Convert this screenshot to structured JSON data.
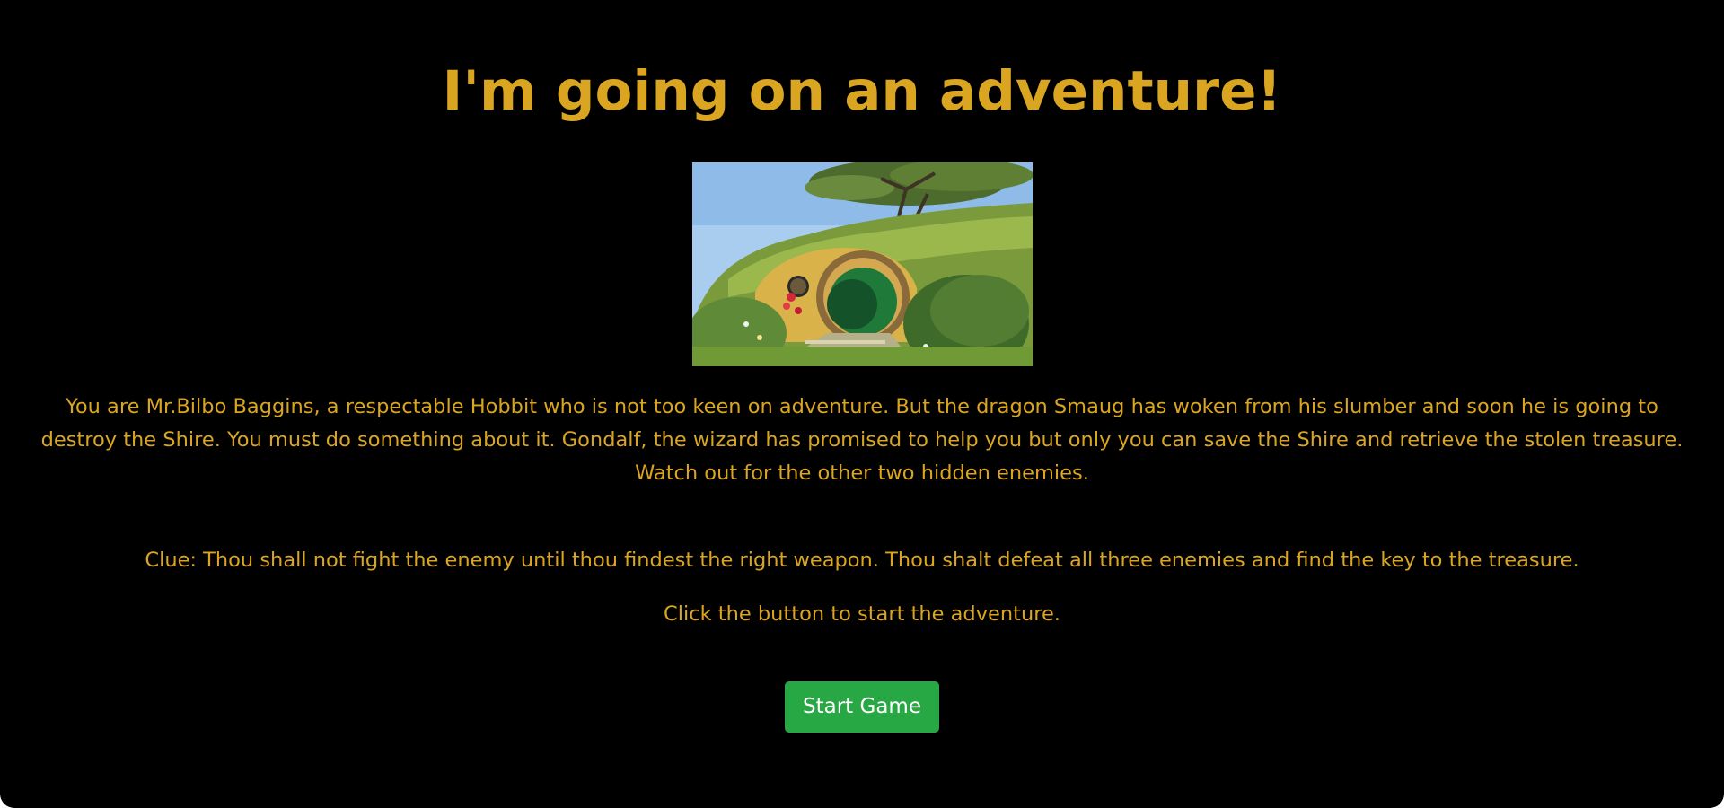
{
  "page": {
    "title": "I'm going on an adventure!",
    "hero_image": {
      "description_icon": "hobbit-hole-illustration"
    },
    "intro_text": "You are Mr.Bilbo Baggins, a respectable Hobbit who is not too keen on adventure. But the dragon Smaug has woken from his slumber and soon he is going to destroy the Shire. You must do something about it. Gondalf, the wizard has promised to help you but only you can save the Shire and retrieve the stolen treasure. Watch out for the other two hidden enemies.",
    "clue_text": "Clue: Thou shall not fight the enemy until thou findest the right weapon. Thou shalt defeat all three enemies and find the key to the treasure.",
    "prompt_text": "Click the button to start the adventure.",
    "start_button_label": "Start Game"
  },
  "colors": {
    "background": "#000000",
    "text_gold": "#daa520",
    "button_green": "#28a745",
    "button_text": "#ffffff"
  }
}
